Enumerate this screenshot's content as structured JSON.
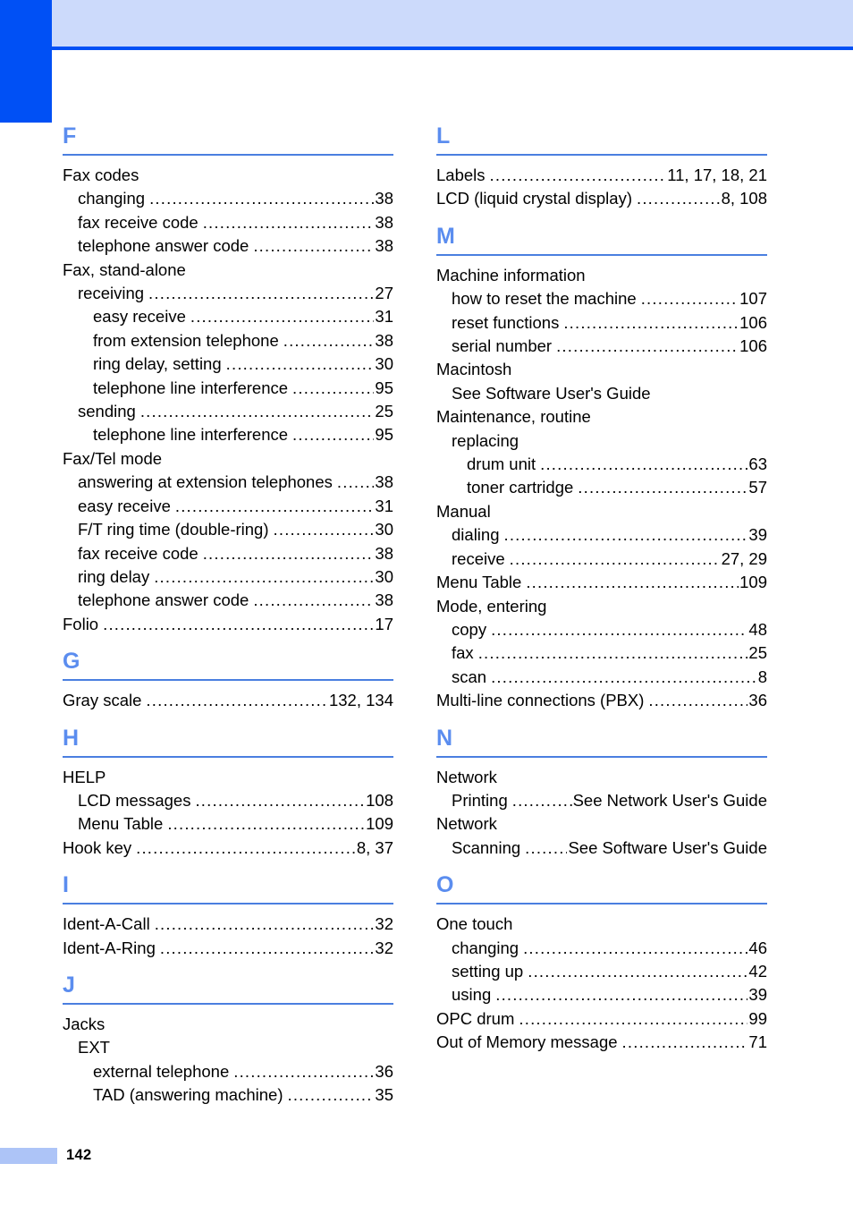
{
  "page": {
    "number": "142",
    "accent_solid": "#0050f5",
    "accent_band": "#ccdafb",
    "accent_letter": "#5b8def",
    "accent_rule": "#4a7fe0",
    "footer_swatch": "#adc4f7"
  },
  "columns": [
    {
      "sections": [
        {
          "letter": "F",
          "entries": [
            {
              "level": 0,
              "term": "Fax codes",
              "pages": ""
            },
            {
              "level": 1,
              "term": "changing",
              "pages": "38"
            },
            {
              "level": 1,
              "term": "fax receive code",
              "pages": "38"
            },
            {
              "level": 1,
              "term": "telephone answer code",
              "pages": "38"
            },
            {
              "level": 0,
              "term": "Fax, stand-alone",
              "pages": ""
            },
            {
              "level": 1,
              "term": "receiving",
              "pages": "27"
            },
            {
              "level": 2,
              "term": "easy receive",
              "pages": "31"
            },
            {
              "level": 2,
              "term": "from extension telephone",
              "pages": "38"
            },
            {
              "level": 2,
              "term": "ring delay, setting",
              "pages": "30"
            },
            {
              "level": 2,
              "term": "telephone line interference",
              "pages": "95"
            },
            {
              "level": 1,
              "term": "sending",
              "pages": "25"
            },
            {
              "level": 2,
              "term": "telephone line interference",
              "pages": "95"
            },
            {
              "level": 0,
              "term": "Fax/Tel mode",
              "pages": ""
            },
            {
              "level": 1,
              "term": "answering at extension telephones",
              "pages": "38"
            },
            {
              "level": 1,
              "term": "easy receive",
              "pages": "31"
            },
            {
              "level": 1,
              "term": "F/T ring time (double-ring)",
              "pages": "30"
            },
            {
              "level": 1,
              "term": "fax receive code",
              "pages": "38"
            },
            {
              "level": 1,
              "term": "ring delay",
              "pages": "30"
            },
            {
              "level": 1,
              "term": "telephone answer code",
              "pages": "38"
            },
            {
              "level": 0,
              "term": "Folio",
              "pages": "17"
            }
          ]
        },
        {
          "letter": "G",
          "entries": [
            {
              "level": 0,
              "term": "Gray scale",
              "pages": "132, 134"
            }
          ]
        },
        {
          "letter": "H",
          "entries": [
            {
              "level": 0,
              "term": "HELP",
              "pages": ""
            },
            {
              "level": 1,
              "term": "LCD messages",
              "pages": "108"
            },
            {
              "level": 1,
              "term": "Menu Table",
              "pages": "109"
            },
            {
              "level": 0,
              "term": "Hook key",
              "pages": "8, 37"
            }
          ]
        },
        {
          "letter": "I",
          "entries": [
            {
              "level": 0,
              "term": "Ident-A-Call",
              "pages": "32"
            },
            {
              "level": 0,
              "term": "Ident-A-Ring",
              "pages": "32"
            }
          ]
        },
        {
          "letter": "J",
          "entries": [
            {
              "level": 0,
              "term": "Jacks",
              "pages": ""
            },
            {
              "level": 1,
              "term": "EXT",
              "pages": ""
            },
            {
              "level": 2,
              "term": "external telephone",
              "pages": "36"
            },
            {
              "level": 2,
              "term": "TAD (answering machine)",
              "pages": "35"
            }
          ]
        }
      ]
    },
    {
      "sections": [
        {
          "letter": "L",
          "entries": [
            {
              "level": 0,
              "term": "Labels",
              "pages": "11, 17, 18, 21"
            },
            {
              "level": 0,
              "term": "LCD (liquid crystal display)",
              "pages": "8, 108"
            }
          ]
        },
        {
          "letter": "M",
          "entries": [
            {
              "level": 0,
              "term": "Machine information",
              "pages": ""
            },
            {
              "level": 1,
              "term": "how to reset the machine",
              "pages": "107"
            },
            {
              "level": 1,
              "term": "reset functions",
              "pages": "106"
            },
            {
              "level": 1,
              "term": "serial number",
              "pages": "106"
            },
            {
              "level": 0,
              "term": "Macintosh",
              "pages": ""
            },
            {
              "level": 1,
              "term": "See Software User's Guide",
              "pages": ""
            },
            {
              "level": 0,
              "term": "Maintenance, routine",
              "pages": ""
            },
            {
              "level": 1,
              "term": "replacing",
              "pages": ""
            },
            {
              "level": 2,
              "term": "drum unit",
              "pages": "63"
            },
            {
              "level": 2,
              "term": "toner cartridge",
              "pages": "57"
            },
            {
              "level": 0,
              "term": "Manual",
              "pages": ""
            },
            {
              "level": 1,
              "term": "dialing",
              "pages": "39"
            },
            {
              "level": 1,
              "term": "receive",
              "pages": "27, 29"
            },
            {
              "level": 0,
              "term": "Menu Table",
              "pages": "109"
            },
            {
              "level": 0,
              "term": "Mode, entering",
              "pages": ""
            },
            {
              "level": 1,
              "term": "copy",
              "pages": "48"
            },
            {
              "level": 1,
              "term": "fax",
              "pages": "25"
            },
            {
              "level": 1,
              "term": "scan",
              "pages": "8"
            },
            {
              "level": 0,
              "term": "Multi-line connections (PBX)",
              "pages": "36"
            }
          ]
        },
        {
          "letter": "N",
          "entries": [
            {
              "level": 0,
              "term": "Network",
              "pages": ""
            },
            {
              "level": 1,
              "term": "Printing",
              "pages": "See Network User's Guide"
            },
            {
              "level": 0,
              "term": "Network",
              "pages": ""
            },
            {
              "level": 1,
              "term": "Scanning",
              "pages": "See Software User's Guide"
            }
          ]
        },
        {
          "letter": "O",
          "entries": [
            {
              "level": 0,
              "term": "One touch",
              "pages": ""
            },
            {
              "level": 1,
              "term": "changing",
              "pages": "46"
            },
            {
              "level": 1,
              "term": "setting up",
              "pages": "42"
            },
            {
              "level": 1,
              "term": "using",
              "pages": "39"
            },
            {
              "level": 0,
              "term": "OPC drum",
              "pages": "99"
            },
            {
              "level": 0,
              "term": "Out of Memory message",
              "pages": "71"
            }
          ]
        }
      ]
    }
  ]
}
